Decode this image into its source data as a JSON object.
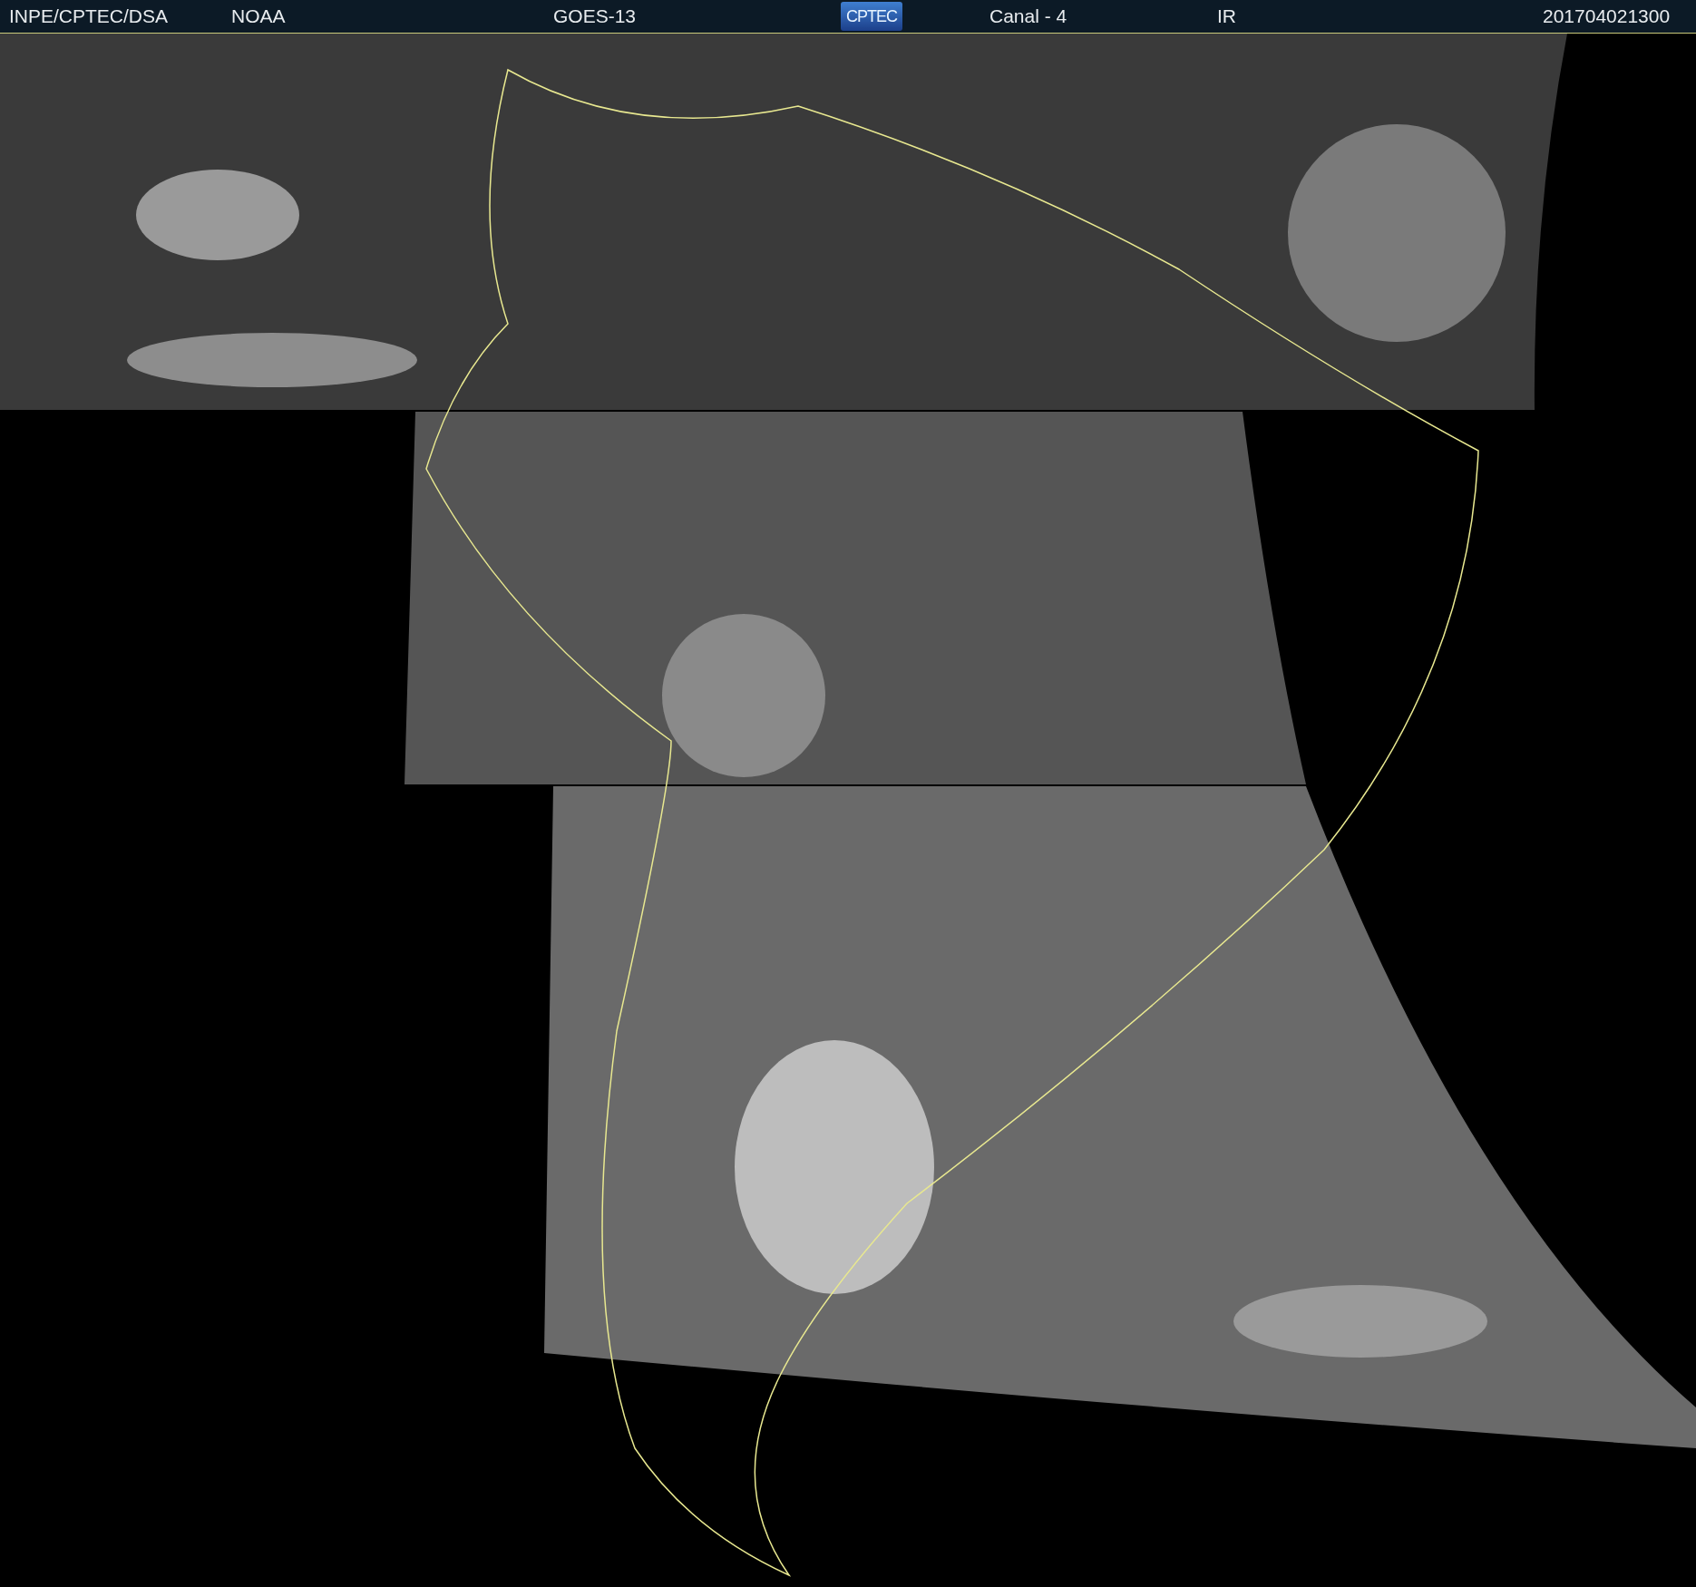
{
  "header": {
    "items": [
      {
        "kind": "text",
        "text": "INPE/CPTEC/DSA"
      },
      {
        "kind": "text",
        "text": "NOAA"
      },
      {
        "kind": "text",
        "text": "GOES-13"
      },
      {
        "kind": "logo",
        "text": "CPTEC"
      },
      {
        "kind": "text",
        "text": "Canal - 4"
      },
      {
        "kind": "text",
        "text": "IR"
      },
      {
        "kind": "text",
        "text": "201704021300"
      }
    ]
  }
}
